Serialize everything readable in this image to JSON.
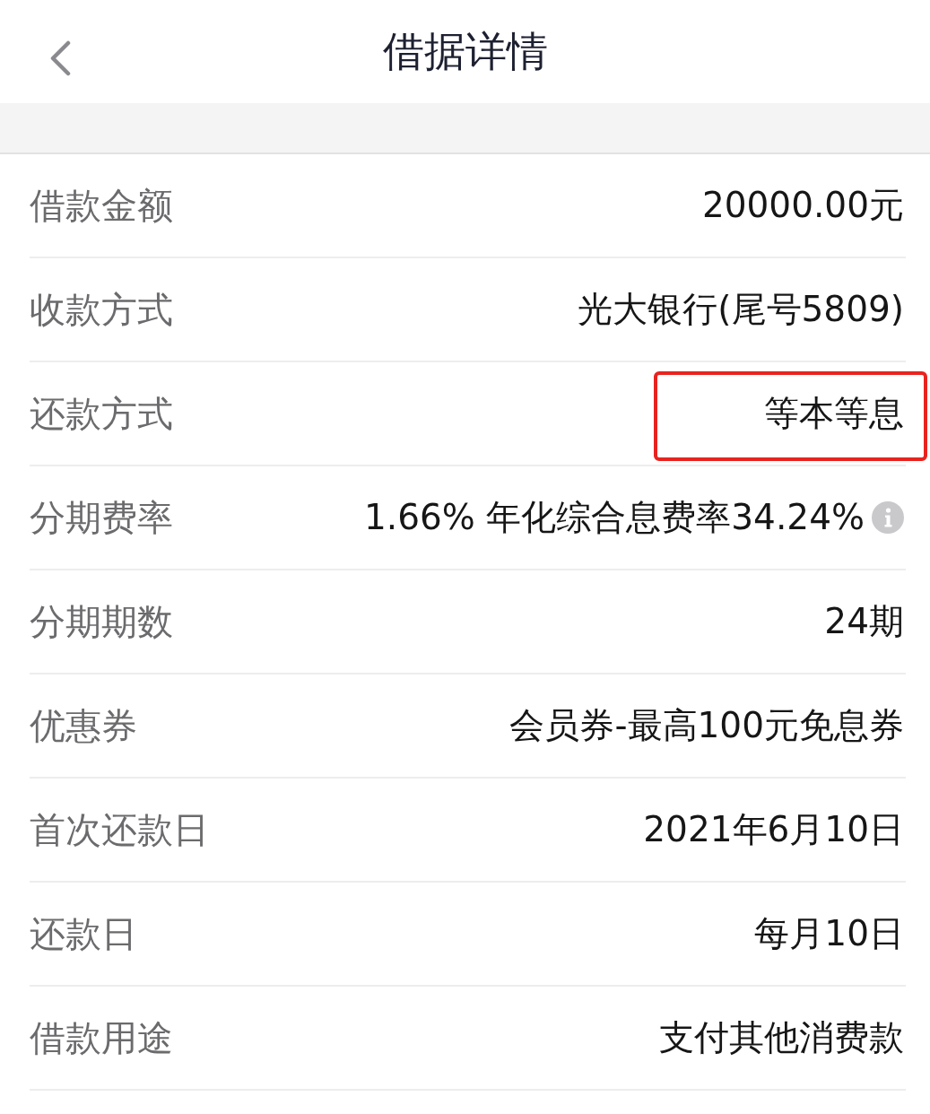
{
  "header": {
    "title": "借据详情"
  },
  "rows": [
    {
      "label": "借款金额",
      "value": "20000.00元",
      "highlighted": false,
      "info": false
    },
    {
      "label": "收款方式",
      "value": "光大银行(尾号5809)",
      "highlighted": false,
      "info": false
    },
    {
      "label": "还款方式",
      "value": "等本等息",
      "highlighted": true,
      "info": false
    },
    {
      "label": "分期费率",
      "value": "1.66% 年化综合息费率34.24%",
      "highlighted": false,
      "info": true
    },
    {
      "label": "分期期数",
      "value": "24期",
      "highlighted": false,
      "info": false
    },
    {
      "label": "优惠券",
      "value": "会员券-最高100元免息券",
      "highlighted": false,
      "info": false
    },
    {
      "label": "首次还款日",
      "value": "2021年6月10日",
      "highlighted": false,
      "info": false
    },
    {
      "label": "还款日",
      "value": "每月10日",
      "highlighted": false,
      "info": false
    },
    {
      "label": "借款用途",
      "value": "支付其他消费款",
      "highlighted": false,
      "info": false
    }
  ]
}
